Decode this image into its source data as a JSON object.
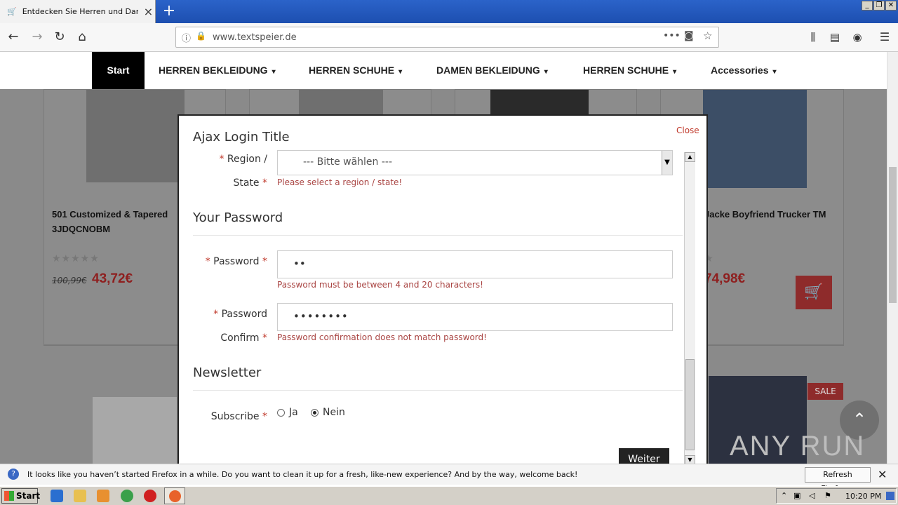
{
  "browser": {
    "tab_title": "Entdecken Sie Herren und Damen",
    "url": "www.textspeier.de",
    "new_tab": "+"
  },
  "site_nav": {
    "start": "Start",
    "items": [
      "HERREN BEKLEIDUNG",
      "HERREN SCHUHE",
      "DAMEN BEKLEIDUNG",
      "HERREN SCHUHE",
      "Accessories"
    ]
  },
  "products": {
    "left_name": "501 Customized & Tapered 3JDQCNOBM",
    "left_old_price": "100,99€",
    "left_price": "43,72€",
    "right_name": "Jacke Boyfriend Trucker TM",
    "right_price": "74,98€",
    "sale": "SALE"
  },
  "modal": {
    "title": "Ajax Login Title",
    "close": "Close",
    "region_label_1": "Region /",
    "region_label_2": "State",
    "region_value": "--- Bitte wählen ---",
    "region_error": "Please select a region / state!",
    "password_section": "Your Password",
    "password_label": "Password",
    "password_value": "••",
    "password_error": "Password must be between 4 and 20 characters!",
    "confirm_label_1": "Password",
    "confirm_label_2": "Confirm",
    "confirm_value": "••••••••",
    "confirm_error": "Password confirmation does not match password!",
    "newsletter_section": "Newsletter",
    "subscribe_label": "Subscribe",
    "option_yes": "Ja",
    "option_no": "Nein",
    "selected_option": "Nein",
    "continue_button": "Weiter"
  },
  "notification": {
    "text": "It looks like you haven’t started Firefox in a while. Do you want to clean it up for a fresh, like-new experience? And by the way, welcome back!",
    "button": "Refresh Firefox…"
  },
  "taskbar": {
    "start": "Start",
    "clock": "10:20 PM"
  },
  "watermark": "ANY RUN",
  "colors": {
    "accent_red": "#c0392b",
    "price_red": "#8e1f1f",
    "title_bar_blue": "#2b63c9"
  }
}
